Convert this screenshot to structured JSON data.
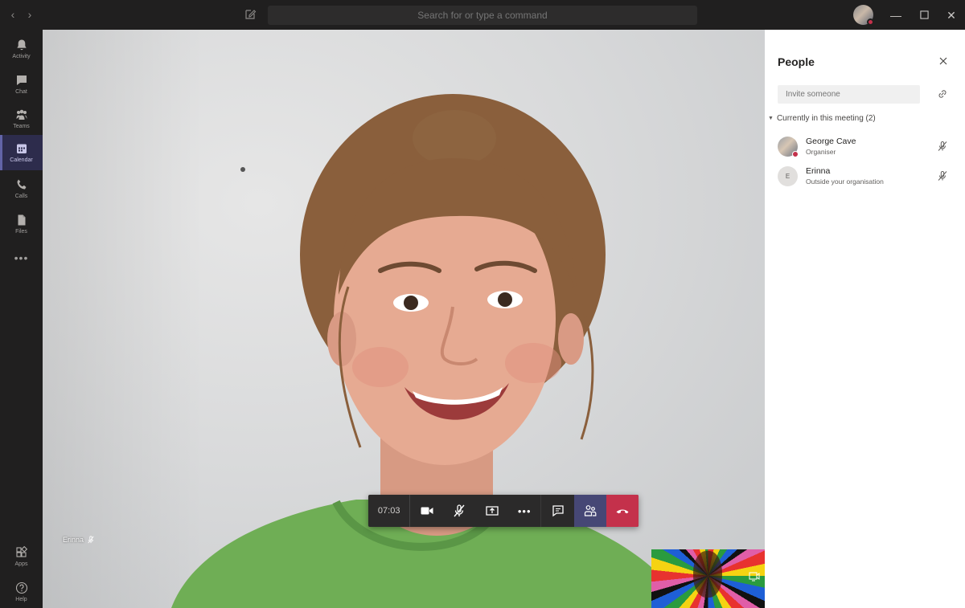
{
  "titlebar": {
    "search_placeholder": "Search for or type a command"
  },
  "appbar": {
    "items": [
      {
        "label": "Activity",
        "icon": "bell-icon"
      },
      {
        "label": "Chat",
        "icon": "chat-icon"
      },
      {
        "label": "Teams",
        "icon": "teams-icon"
      },
      {
        "label": "Calendar",
        "icon": "calendar-icon",
        "active": true
      },
      {
        "label": "Calls",
        "icon": "phone-icon"
      },
      {
        "label": "Files",
        "icon": "file-icon"
      }
    ],
    "more": "•••",
    "bottom": [
      {
        "label": "Apps",
        "icon": "apps-icon"
      },
      {
        "label": "Help",
        "icon": "help-icon"
      }
    ]
  },
  "stage": {
    "participant_name": "Erinna"
  },
  "controls": {
    "timer": "07:03",
    "more": "•••"
  },
  "panel": {
    "title": "People",
    "invite_placeholder": "Invite someone",
    "section": "Currently in this meeting (2)",
    "participants": [
      {
        "name": "George Cave",
        "role": "Organiser",
        "initial": ""
      },
      {
        "name": "Erinna",
        "role": "Outside your organisation",
        "initial": "E"
      }
    ]
  },
  "colors": {
    "accent": "#6264a7",
    "hangup": "#c4314b",
    "dark_bg": "#201f1f"
  }
}
